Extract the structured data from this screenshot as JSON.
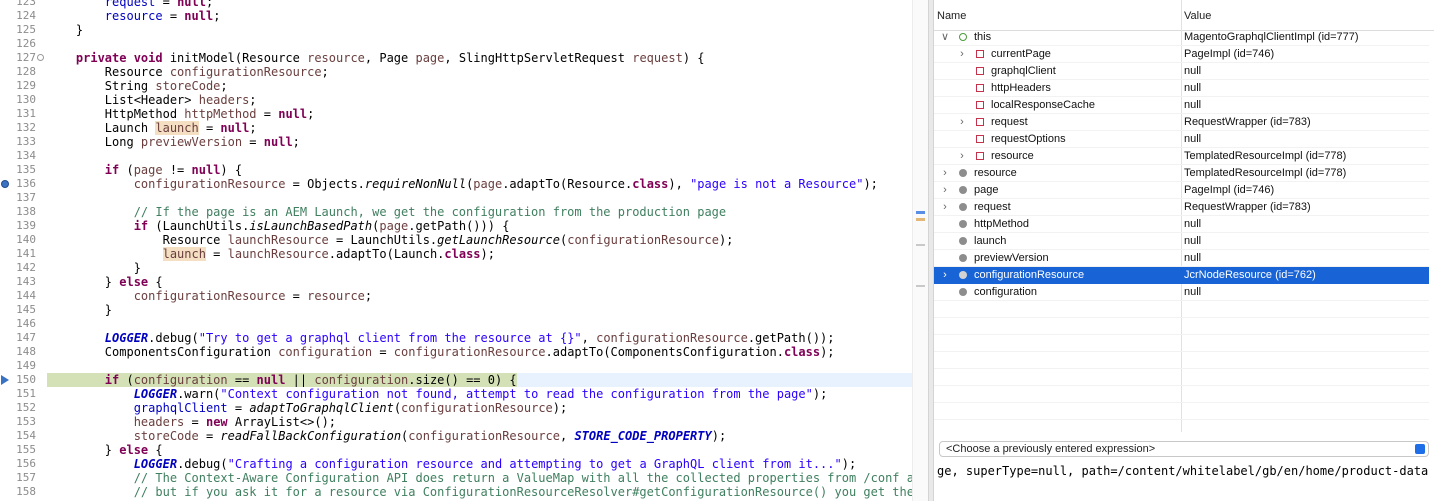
{
  "editor": {
    "lines": [
      {
        "num": "123",
        "html": "        <span class=\"fld\">request</span> = <span class=\"kw\">null</span>;"
      },
      {
        "num": "124",
        "html": "        <span class=\"fld\">resource</span> = <span class=\"kw\">null</span>;"
      },
      {
        "num": "125",
        "html": "    }"
      },
      {
        "num": "126",
        "html": ""
      },
      {
        "num": "127",
        "fold": true,
        "html": "    <span class=\"kw\">private void</span> initModel(Resource <span class=\"var\">resource</span>, Page <span class=\"var\">page</span>, SlingHttpServletRequest <span class=\"var\">request</span>) {"
      },
      {
        "num": "128",
        "html": "        Resource <span class=\"var\">configurationResource</span>;"
      },
      {
        "num": "129",
        "html": "        String <span class=\"var\">storeCode</span>;"
      },
      {
        "num": "130",
        "html": "        List&lt;Header&gt; <span class=\"var\">headers</span>;"
      },
      {
        "num": "131",
        "html": "        HttpMethod <span class=\"var\">httpMethod</span> = <span class=\"kw\">null</span>;"
      },
      {
        "num": "132",
        "html": "        Launch <span class=\"var occ\">launch</span> = <span class=\"kw\">null</span>;"
      },
      {
        "num": "133",
        "html": "        Long <span class=\"var\">previewVersion</span> = <span class=\"kw\">null</span>;"
      },
      {
        "num": "134",
        "html": ""
      },
      {
        "num": "135",
        "html": "        <span class=\"kw\">if</span> (<span class=\"var\">page</span> != <span class=\"kw\">null</span>) {"
      },
      {
        "num": "136",
        "marker": "bp",
        "html": "            <span class=\"var\">configurationResource</span> = Objects.<span class=\"it\">requireNonNull</span>(<span class=\"var\">page</span>.adaptTo(Resource.<span class=\"kw\">class</span>), <span class=\"str\">\"page is not a Resource\"</span>);"
      },
      {
        "num": "137",
        "html": ""
      },
      {
        "num": "138",
        "html": "            <span class=\"cm\">// If the page is an AEM Launch, we get the configuration from the production page</span>"
      },
      {
        "num": "139",
        "html": "            <span class=\"kw\">if</span> (LaunchUtils.<span class=\"it\">isLaunchBasedPath</span>(<span class=\"var\">page</span>.getPath())) {"
      },
      {
        "num": "140",
        "html": "                Resource <span class=\"var\">launchResource</span> = LaunchUtils.<span class=\"it\">getLaunchResource</span>(<span class=\"var\">configurationResource</span>);"
      },
      {
        "num": "141",
        "html": "                <span class=\"var occ\">launch</span> = <span class=\"var\">launchResource</span>.adaptTo(Launch.<span class=\"kw\">class</span>);"
      },
      {
        "num": "142",
        "html": "            }"
      },
      {
        "num": "143",
        "html": "        } <span class=\"kw\">else</span> {"
      },
      {
        "num": "144",
        "html": "            <span class=\"var\">configurationResource</span> = <span class=\"var\">resource</span>;"
      },
      {
        "num": "145",
        "html": "        }"
      },
      {
        "num": "146",
        "html": ""
      },
      {
        "num": "147",
        "html": "        <span class=\"sfld\">LOGGER</span>.debug(<span class=\"str\">\"Try to get a graphql client from the resource at {}\"</span>, <span class=\"var\">configurationResource</span>.getPath());"
      },
      {
        "num": "148",
        "html": "        ComponentsConfiguration <span class=\"var\">configuration</span> = <span class=\"var\">configurationResource</span>.adaptTo(ComponentsConfiguration.<span class=\"kw\">class</span>);"
      },
      {
        "num": "149",
        "html": ""
      },
      {
        "num": "150",
        "marker": "ip",
        "current": true,
        "html": "<span class=\"dbg-hl\">        <span class=\"kw\">if</span> (<span class=\"var\">configuration</span> == <span class=\"kw\">null</span> || <span class=\"var\">configuration</span>.size() == 0) {</span>"
      },
      {
        "num": "151",
        "html": "            <span class=\"sfld\">LOGGER</span>.warn(<span class=\"str\">\"Context configuration not found, attempt to read the configuration from the page\"</span>);"
      },
      {
        "num": "152",
        "html": "            <span class=\"fld\">graphqlClient</span> = <span class=\"it\">adaptToGraphqlClient</span>(<span class=\"var\">configurationResource</span>);"
      },
      {
        "num": "153",
        "html": "            <span class=\"var\">headers</span> = <span class=\"kw\">new</span> ArrayList&lt;&gt;();"
      },
      {
        "num": "154",
        "html": "            <span class=\"var\">storeCode</span> = <span class=\"it\">readFallBackConfiguration</span>(<span class=\"var\">configurationResource</span>, <span class=\"sfld\">STORE_CODE_PROPERTY</span>);"
      },
      {
        "num": "155",
        "html": "        } <span class=\"kw\">else</span> {"
      },
      {
        "num": "156",
        "html": "            <span class=\"sfld\">LOGGER</span>.debug(<span class=\"str\">\"Crafting a configuration resource and attempting to get a GraphQL client from it...\"</span>);"
      },
      {
        "num": "157",
        "html": "            <span class=\"cm\">// The Context-Aware Configuration API does return a ValueMap with all the collected properties from /conf a</span>"
      },
      {
        "num": "158",
        "html": "            <span class=\"cm\">// but if you ask it for a resource via ConfigurationResourceResolver#getConfigurationResource() you get the</span>"
      }
    ]
  },
  "variables": {
    "header": {
      "name": "Name",
      "value": "Value"
    },
    "rows": [
      {
        "indent": 0,
        "expander": "v",
        "icon": "this",
        "name": "this",
        "value": "MagentoGraphqlClientImpl  (id=777)"
      },
      {
        "indent": 1,
        "expander": ">",
        "icon": "fieldp",
        "name": "currentPage",
        "value": "PageImpl  (id=746)"
      },
      {
        "indent": 1,
        "expander": "",
        "icon": "fieldp",
        "name": "graphqlClient",
        "value": "null"
      },
      {
        "indent": 1,
        "expander": "",
        "icon": "fieldp",
        "name": "httpHeaders",
        "value": "null"
      },
      {
        "indent": 1,
        "expander": "",
        "icon": "fieldp",
        "name": "localResponseCache",
        "value": "null"
      },
      {
        "indent": 1,
        "expander": ">",
        "icon": "fieldp",
        "name": "request",
        "value": "RequestWrapper  (id=783)"
      },
      {
        "indent": 1,
        "expander": "",
        "icon": "fieldp",
        "name": "requestOptions",
        "value": "null"
      },
      {
        "indent": 1,
        "expander": ">",
        "icon": "fieldp",
        "name": "resource",
        "value": "TemplatedResourceImpl  (id=778)"
      },
      {
        "indent": 0,
        "expander": ">",
        "icon": "local",
        "name": "resource",
        "value": "TemplatedResourceImpl  (id=778)"
      },
      {
        "indent": 0,
        "expander": ">",
        "icon": "local",
        "name": "page",
        "value": "PageImpl  (id=746)"
      },
      {
        "indent": 0,
        "expander": ">",
        "icon": "local",
        "name": "request",
        "value": "RequestWrapper  (id=783)"
      },
      {
        "indent": 0,
        "expander": "",
        "icon": "local",
        "name": "httpMethod",
        "value": "null"
      },
      {
        "indent": 0,
        "expander": "",
        "icon": "local",
        "name": "launch",
        "value": "null"
      },
      {
        "indent": 0,
        "expander": "",
        "icon": "local",
        "name": "previewVersion",
        "value": "null"
      },
      {
        "indent": 0,
        "expander": ">",
        "icon": "local",
        "name": "configurationResource",
        "value": "JcrNodeResource  (id=762)",
        "selected": true
      },
      {
        "indent": 0,
        "expander": "",
        "icon": "local",
        "name": "configuration",
        "value": "null"
      }
    ],
    "expression_placeholder": "<Choose a previously entered expression>",
    "detail_text": "ge, superType=null, path=/content/whitelabel/gb/en/home/product-data"
  },
  "colors": {
    "selection": "#1863d6",
    "current_line": "#e8f2fe",
    "debug_highlight": "#d4e1b6"
  }
}
